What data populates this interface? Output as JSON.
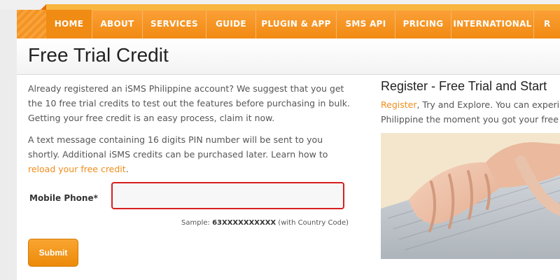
{
  "nav": {
    "items": [
      {
        "label": "HOME"
      },
      {
        "label": "ABOUT"
      },
      {
        "label": "SERVICES"
      },
      {
        "label": "GUIDE"
      },
      {
        "label": "PLUGIN & APP"
      },
      {
        "label": "SMS API"
      },
      {
        "label": "PRICING"
      },
      {
        "label": "INTERNATIONAL"
      },
      {
        "label": "R"
      }
    ]
  },
  "page": {
    "title": "Free Trial Credit"
  },
  "intro": {
    "p1": "Already registered an iSMS Philippine account? We suggest that you get the 10 free trial credits to test out the features before purchasing in bulk. Getting your free credit is an easy process, claim it now.",
    "p2_text": "A text message containing 16 digits PIN number will be sent to you shortly. Additional iSMS credits can be purchased later. Learn how to ",
    "p2_link": "reload your free credit",
    "p2_end": "."
  },
  "form": {
    "phone_label": "Mobile Phone*",
    "phone_value": "",
    "sample_prefix": "Sample: ",
    "sample_number": "63XXXXXXXXXX",
    "sample_suffix": " (with Country Code)",
    "submit_label": "Submit"
  },
  "right": {
    "title": "Register - Free Trial and Start",
    "link": "Register",
    "text1": ", Try and Explore. You can experience",
    "text2": "Philippine the moment you got your free iSMS"
  },
  "colors": {
    "accent": "#f7941d",
    "link": "#f28c1a",
    "error_border": "#d81f1f"
  }
}
